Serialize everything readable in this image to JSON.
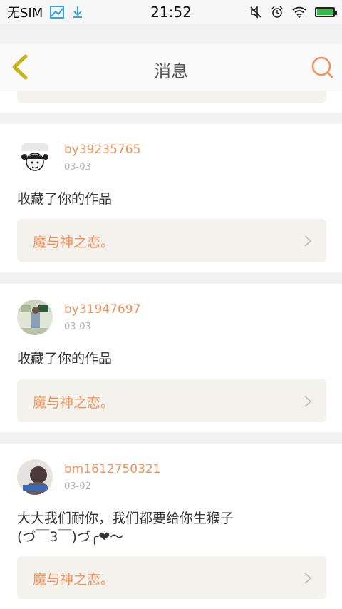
{
  "status_bar": {
    "carrier": "无SIM",
    "time": "21:52",
    "battery_level": 1.0
  },
  "navbar": {
    "title": "消息",
    "back_icon": "chevron-left-icon",
    "search_icon": "search-icon"
  },
  "notifications": [
    {
      "username": "by39235765",
      "date": "03-03",
      "message": "收藏了你的作品",
      "work_title": "魔与神之恋。"
    },
    {
      "username": "by31947697",
      "date": "03-03",
      "message": "收藏了你的作品",
      "work_title": "魔与神之恋。"
    },
    {
      "username": "bm1612750321",
      "date": "03-02",
      "message": "大大我们耐你，我们都要给你生猴子(づ￣3￣)づ╭❤～",
      "work_title": "魔与神之恋。"
    }
  ],
  "colors": {
    "accent": "#f0915a",
    "back_icon": "#c8b21a",
    "card_bg": "#ffffff",
    "link_bg": "#f4f2ec"
  }
}
